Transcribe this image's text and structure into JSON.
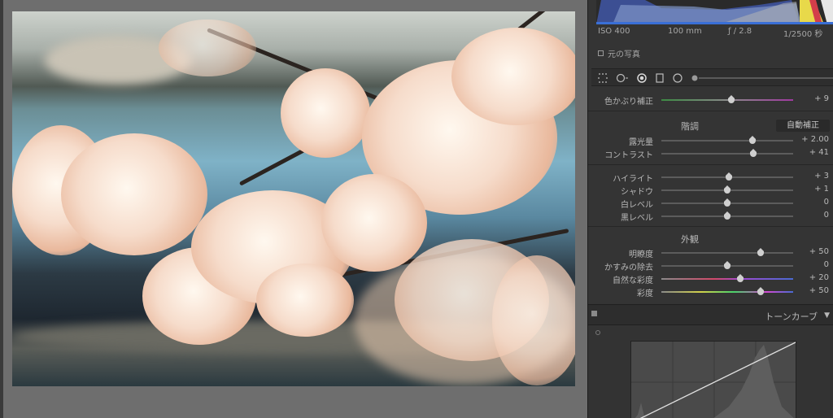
{
  "exif": {
    "iso": "ISO 400",
    "focal": "100 mm",
    "aperture": "ƒ / 2.8",
    "shutter": "1/2500 秒"
  },
  "original_photo_label": "元の写真",
  "color_cast": {
    "label": "色かぶり補正",
    "value": "+ 9",
    "level": 0.53
  },
  "tone_section": {
    "title": "階調",
    "auto_button": "自動補正"
  },
  "tone_sliders": [
    {
      "label": "露光量",
      "value": "+ 2.00",
      "level": 0.69
    },
    {
      "label": "コントラスト",
      "value": "+ 41",
      "level": 0.7
    }
  ],
  "light_sliders": [
    {
      "label": "ハイライト",
      "value": "+ 3",
      "level": 0.51
    },
    {
      "label": "シャドウ",
      "value": "+ 1",
      "level": 0.5
    },
    {
      "label": "白レベル",
      "value": "0",
      "level": 0.5
    },
    {
      "label": "黒レベル",
      "value": "0",
      "level": 0.5
    }
  ],
  "presence_section": {
    "title": "外観"
  },
  "presence_sliders": [
    {
      "label": "明瞭度",
      "value": "+ 50",
      "level": 0.75
    },
    {
      "label": "かすみの除去",
      "value": "0",
      "level": 0.5
    },
    {
      "label": "自然な彩度",
      "value": "+ 20",
      "level": 0.6
    },
    {
      "label": "彩度",
      "value": "+ 50",
      "level": 0.75
    }
  ],
  "tone_curve": {
    "label": "トーンカーブ"
  },
  "colors": {
    "panel": "#343434",
    "canvas": "#6e6e6e",
    "text": "#b8b8b8"
  }
}
